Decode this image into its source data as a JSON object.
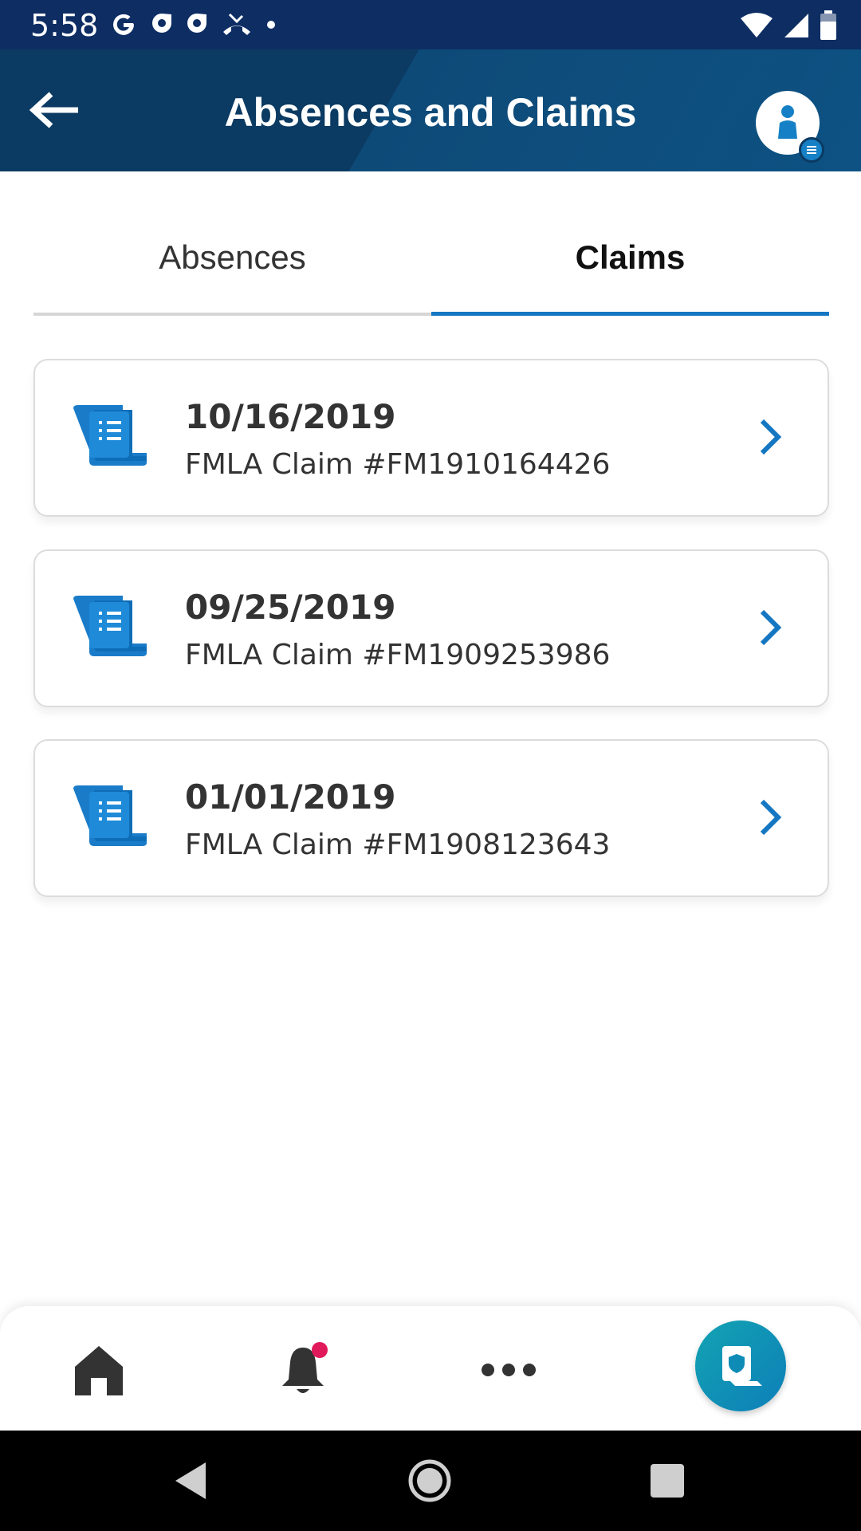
{
  "status_bar": {
    "time": "5:58",
    "left_icons": [
      "google-icon",
      "app-icon",
      "app-icon",
      "missed-call-icon",
      "dot-icon"
    ],
    "right_icons": [
      "wifi-icon",
      "signal-icon",
      "battery-icon"
    ]
  },
  "header": {
    "title": "Absences and Claims",
    "back_icon": "arrow-left-icon",
    "profile_icon": "profile-menu-icon"
  },
  "tabs": [
    {
      "label": "Absences",
      "active": false
    },
    {
      "label": "Claims",
      "active": true
    }
  ],
  "claims": [
    {
      "date": "10/16/2019",
      "description": "FMLA Claim #FM1910164426"
    },
    {
      "date": "09/25/2019",
      "description": "FMLA Claim #FM1909253986"
    },
    {
      "date": "01/01/2019",
      "description": "FMLA Claim #FM1908123643"
    }
  ],
  "bottom_nav": {
    "items": [
      "home-icon",
      "bell-icon",
      "more-icon",
      "claims-fab-icon"
    ],
    "notification_dot": true
  },
  "colors": {
    "status_bar": "#0d2d63",
    "header": "#0b3a62",
    "accent": "#1577c2",
    "notification": "#e0195a",
    "fab": "#13a3b3"
  }
}
